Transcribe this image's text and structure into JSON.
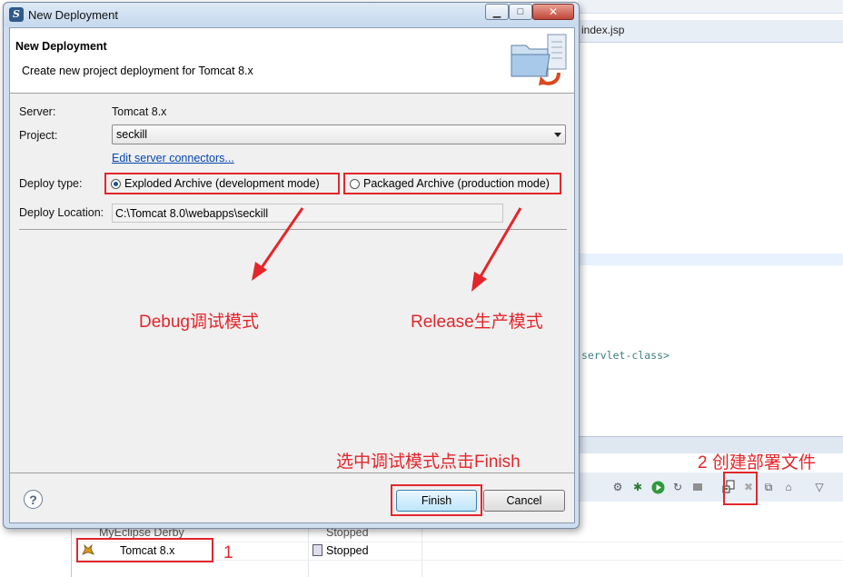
{
  "dialog": {
    "title": "New Deployment",
    "header_title": "New Deployment",
    "header_description": "Create new project deployment for Tomcat  8.x",
    "server_label": "Server:",
    "server_value": "Tomcat  8.x",
    "project_label": "Project:",
    "project_value": "seckill",
    "edit_connectors_link": "Edit server connectors...",
    "deploy_type_label": "Deploy type:",
    "deploy_types": [
      {
        "label": "Exploded Archive (development mode)",
        "selected": true
      },
      {
        "label": "Packaged Archive (production mode)",
        "selected": false
      }
    ],
    "deploy_location_label": "Deploy Location:",
    "deploy_location_value": "C:\\Tomcat 8.0\\webapps\\seckill",
    "help_label": "?",
    "finish_label": "Finish",
    "cancel_label": "Cancel"
  },
  "annotations": {
    "debug": "Debug调试模式",
    "release": "Release生产模式",
    "select_finish": "选中调试模式点击Finish",
    "create_deploy": "2 创建部署文件",
    "step_one": "1",
    "color": "#e3262b"
  },
  "ide": {
    "editor_tab": "index.jsp",
    "code_fragment": "servlet-class>",
    "servers": [
      {
        "name": "MyEclipse Derby",
        "state": "Stopped"
      },
      {
        "name": "Tomcat  8.x",
        "state": "Stopped"
      }
    ]
  },
  "icons": {
    "app": "myeclipse-icon",
    "header": "deployment-folder-icon",
    "tomcat": "tomcat-cat-icon"
  }
}
